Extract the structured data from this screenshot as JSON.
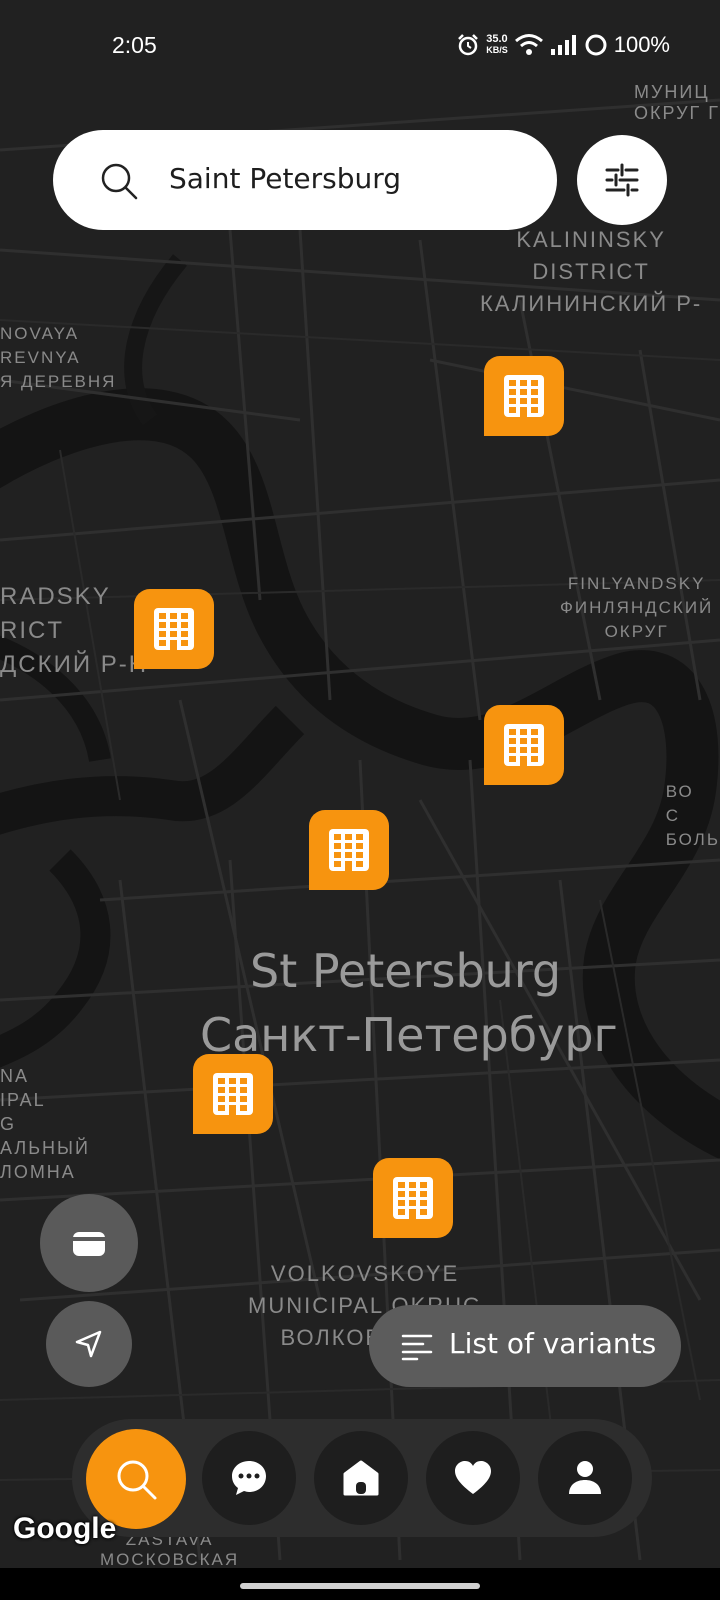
{
  "status_bar": {
    "time": "2:05",
    "speed_value": "35.0",
    "speed_unit": "KB/S",
    "battery": "100%"
  },
  "search": {
    "value": "Saint Petersburg",
    "icon": "search-icon"
  },
  "filter_button": {
    "icon": "sliders-icon"
  },
  "map": {
    "city_name_en": "St Petersburg",
    "city_name_ru": "Санкт-Петербург",
    "labels": {
      "kalininsky_1": "KALININSKY",
      "kalininsky_2": "DISTRICT",
      "kalininsky_3": "КАЛИНИНСКИЙ Р-",
      "municipal_1": "МУНИЦ",
      "municipal_2": "ОКРУГ Г",
      "novaya_1": "NOVAYA",
      "novaya_2": "REVNYA",
      "novaya_3": "Я ДЕРЕВНЯ",
      "gradsky_1": "RADSKY",
      "gradsky_2": "RICT",
      "gradsky_3": "ДСКИЙ Р-Н",
      "finlyandsky_1": "FINLYANDSKY",
      "finlyandsky_2": "ФИНЛЯНДСКИЙ",
      "finlyandsky_3": "ОКРУГ",
      "bol_1": "ВО",
      "bol_2": "С",
      "bol_3": "БОЛЬ",
      "kolomna_1": "NA",
      "kolomna_2": "IPAL",
      "kolomna_3": "G",
      "kolomna_4": "АЛЬНЫЙ",
      "kolomna_5": "ЛОМНА",
      "volkovskoye_1": "VOLKOVSKOYE",
      "volkovskoye_2": "MUNICIPAL OKRUG",
      "volkovskoye_3": "ВОЛКОВСКОЕ",
      "zastava_1": "ZASTAVA",
      "zastava_2": "МОСКОВСКАЯ"
    },
    "pin_icon": "building-icon",
    "pin_color": "#f7940f"
  },
  "floating": {
    "wallet_icon": "wallet-icon",
    "location_icon": "navigation-arrow-icon",
    "list_button_label": "List of variants",
    "list_icon": "list-lines-icon"
  },
  "bottom_nav": {
    "items": [
      {
        "icon": "search-icon",
        "active": true
      },
      {
        "icon": "chat-bubble-icon",
        "active": false
      },
      {
        "icon": "home-icon",
        "active": false
      },
      {
        "icon": "heart-icon",
        "active": false
      },
      {
        "icon": "profile-icon",
        "active": false
      }
    ],
    "accent": "#f7940f"
  },
  "attribution": "Google"
}
